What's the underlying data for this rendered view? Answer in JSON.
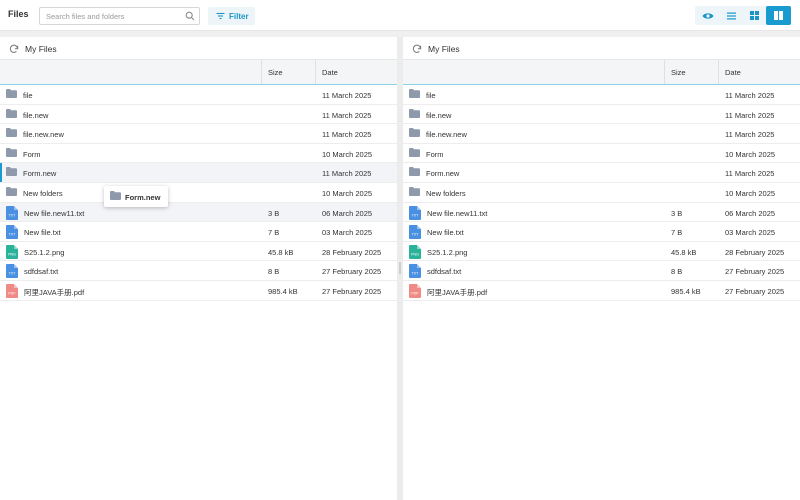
{
  "app": {
    "title": "Files"
  },
  "search": {
    "placeholder": "Search files and folders",
    "icon": "search-icon"
  },
  "filter": {
    "label": "Filter",
    "icon": "filter-icon"
  },
  "view_modes": [
    {
      "name": "preview-toggle",
      "icon": "eye-icon",
      "active": false
    },
    {
      "name": "list-view",
      "icon": "list-icon",
      "active": false
    },
    {
      "name": "grid-view",
      "icon": "grid-icon",
      "active": false
    },
    {
      "name": "split-view",
      "icon": "split-panel-icon",
      "active": true
    }
  ],
  "colors": {
    "accent": "#1a9bd0",
    "folder": "#8e9aab",
    "txt": "#4a90e2",
    "png": "#2bb39a",
    "pdf": "#f08a86"
  },
  "columns": {
    "size": "Size",
    "date": "Date"
  },
  "left_panel": {
    "title": "My Files",
    "rows": [
      {
        "name": "file",
        "type": "folder",
        "size": "",
        "date": "11 March 2025"
      },
      {
        "name": "file.new",
        "type": "folder",
        "size": "",
        "date": "11 March 2025"
      },
      {
        "name": "file.new.new",
        "type": "folder",
        "size": "",
        "date": "11 March 2025"
      },
      {
        "name": "Form",
        "type": "folder",
        "size": "",
        "date": "10 March 2025"
      },
      {
        "name": "Form.new",
        "type": "folder",
        "size": "",
        "date": "11 March 2025"
      },
      {
        "name": "New folders",
        "type": "folder",
        "size": "",
        "date": "10 March 2025"
      },
      {
        "name": "New file.new11.txt",
        "type": "txt",
        "size": "3 B",
        "date": "06 March 2025"
      },
      {
        "name": "New file.txt",
        "type": "txt",
        "size": "7 B",
        "date": "03 March 2025"
      },
      {
        "name": "S25.1.2.png",
        "type": "png",
        "size": "45.8 kB",
        "date": "28 February 2025"
      },
      {
        "name": "sdfdsaf.txt",
        "type": "txt",
        "size": "8 B",
        "date": "27 February 2025"
      },
      {
        "name": "阿里JAVA手册.pdf",
        "type": "pdf",
        "size": "985.4 kB",
        "date": "27 February 2025"
      }
    ]
  },
  "right_panel": {
    "title": "My Files",
    "rows": [
      {
        "name": "file",
        "type": "folder",
        "size": "",
        "date": "11 March 2025"
      },
      {
        "name": "file.new",
        "type": "folder",
        "size": "",
        "date": "11 March 2025"
      },
      {
        "name": "file.new.new",
        "type": "folder",
        "size": "",
        "date": "11 March 2025"
      },
      {
        "name": "Form",
        "type": "folder",
        "size": "",
        "date": "10 March 2025"
      },
      {
        "name": "Form.new",
        "type": "folder",
        "size": "",
        "date": "11 March 2025"
      },
      {
        "name": "New folders",
        "type": "folder",
        "size": "",
        "date": "10 March 2025"
      },
      {
        "name": "New file.new11.txt",
        "type": "txt",
        "size": "3 B",
        "date": "06 March 2025"
      },
      {
        "name": "New file.txt",
        "type": "txt",
        "size": "7 B",
        "date": "03 March 2025"
      },
      {
        "name": "S25.1.2.png",
        "type": "png",
        "size": "45.8 kB",
        "date": "28 February 2025"
      },
      {
        "name": "sdfdsaf.txt",
        "type": "txt",
        "size": "8 B",
        "date": "27 February 2025"
      },
      {
        "name": "阿里JAVA手册.pdf",
        "type": "pdf",
        "size": "985.4 kB",
        "date": "27 February 2025"
      }
    ]
  },
  "drag_ghost": {
    "name": "Form.new",
    "icon": "folder-icon"
  }
}
